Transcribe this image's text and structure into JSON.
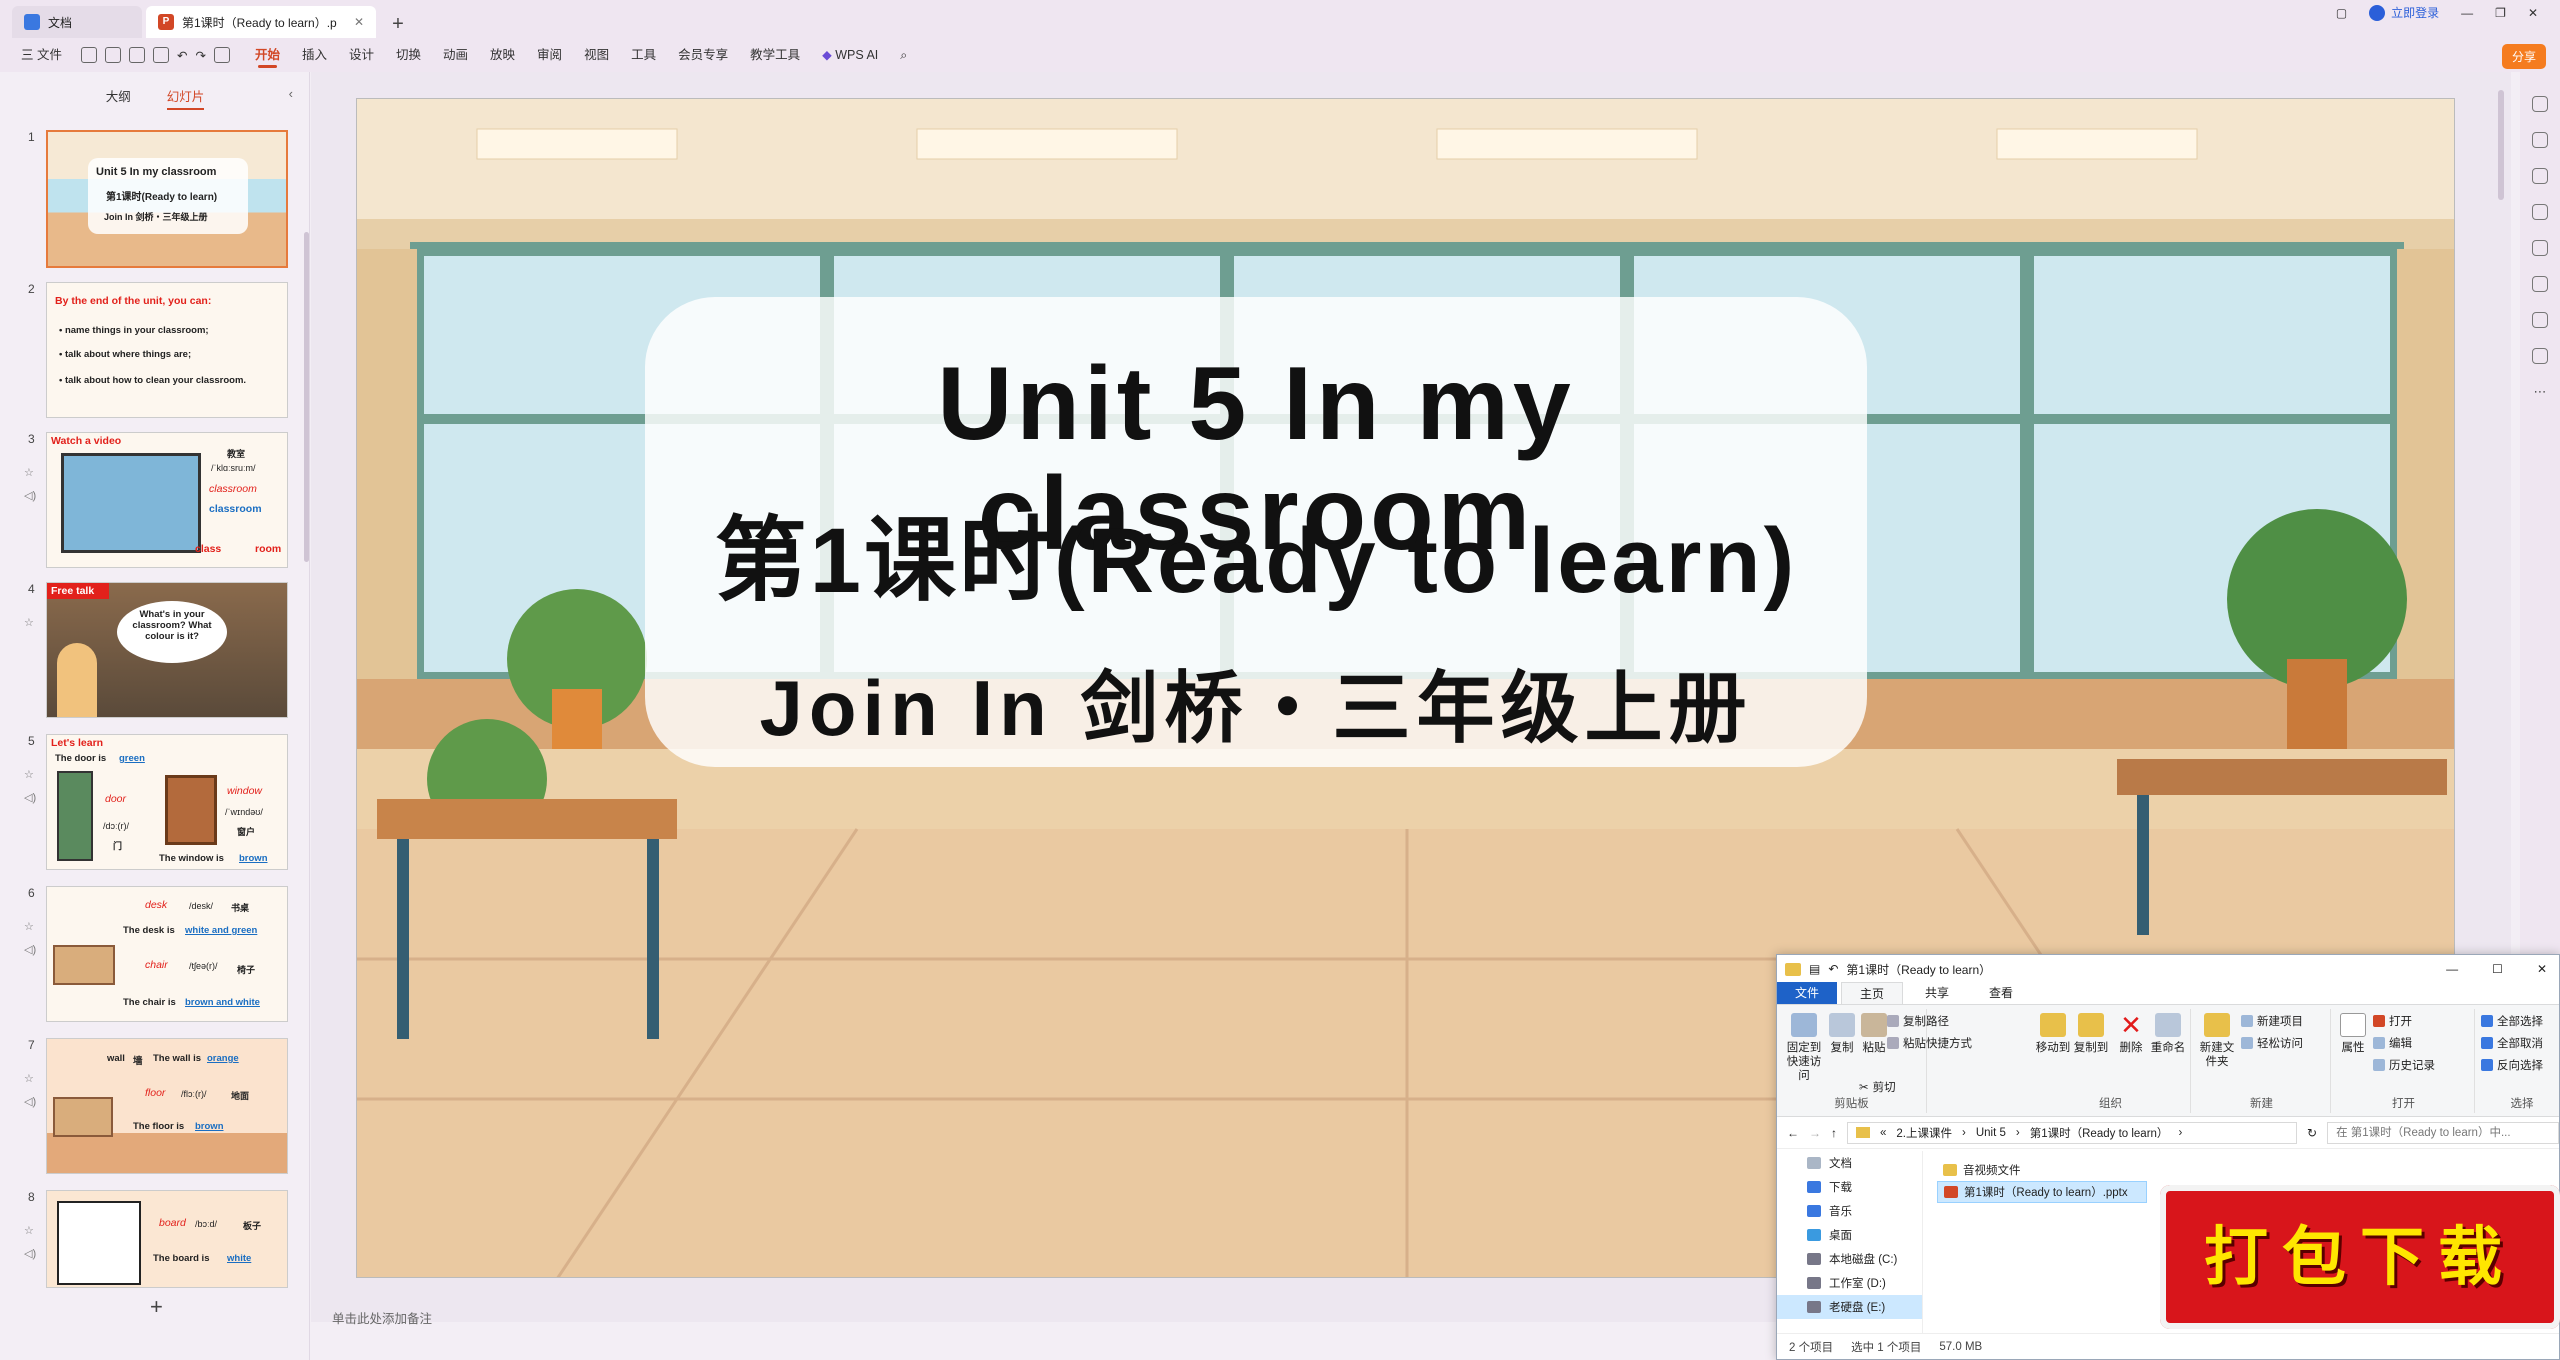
{
  "titlebar": {
    "tabs": [
      {
        "label": "文档"
      },
      {
        "label": "第1课时（Ready to learn）.p"
      }
    ],
    "login": "立即登录"
  },
  "menubar": {
    "file": "三 文件",
    "items": [
      "开始",
      "插入",
      "设计",
      "切换",
      "动画",
      "放映",
      "审阅",
      "视图",
      "工具",
      "会员专享",
      "教学工具"
    ],
    "active": "开始",
    "wps_ai": "WPS AI",
    "share": "分享"
  },
  "leftpanel": {
    "tabs": {
      "outline": "大纲",
      "slides": "幻灯片"
    },
    "thumbs": [
      {
        "num": "1",
        "lines": [
          "Unit 5 In my classroom",
          "第1课时(Ready to learn)",
          "Join In 剑桥・三年级上册"
        ]
      },
      {
        "num": "2",
        "title": "By the end of the unit, you can:",
        "bullets": [
          "name things in your classroom;",
          "talk about where things are;",
          "talk about how to clean your classroom."
        ]
      },
      {
        "num": "3",
        "title": "Watch a video",
        "words": [
          "教室",
          "/ˈklɑːsruːm/",
          "classroom",
          "classroom",
          "class",
          "room"
        ]
      },
      {
        "num": "4",
        "title": "Free talk",
        "bubble": "What's in your classroom? What colour is it?"
      },
      {
        "num": "5",
        "title": "Let's learn",
        "lines": [
          "The door is",
          "green",
          "door",
          "window",
          "/dɔː(r)/",
          "门",
          "/ˈwɪndəʊ/",
          "窗户",
          "The window is",
          "brown"
        ]
      },
      {
        "num": "6",
        "lines": [
          "desk",
          "/desk/",
          "书桌",
          "The desk is",
          "white and green",
          "chair",
          "/tʃeə(r)/",
          "椅子",
          "The chair is",
          "brown and white"
        ]
      },
      {
        "num": "7",
        "lines": [
          "wall",
          "墙",
          "The wall is",
          "orange",
          "floor",
          "/flɔː(r)/",
          "地面",
          "The floor is",
          "brown"
        ]
      },
      {
        "num": "8",
        "lines": [
          "board",
          "/bɔːd/",
          "板子",
          "The board is",
          "white"
        ]
      }
    ]
  },
  "slide": {
    "title": "Unit 5 In my classroom",
    "subtitle": "第1课时(Ready to learn)",
    "book": "Join In 剑桥・三年级上册"
  },
  "notes_placeholder": "单击此处添加备注",
  "explorer": {
    "title": "第1课时（Ready to learn）",
    "tabs": [
      "文件",
      "主页",
      "共享",
      "查看"
    ],
    "ribbon": {
      "clipboard": {
        "label": "剪贴板",
        "pin": "固定到快速访问",
        "copy": "复制",
        "paste": "粘贴",
        "copy_path": "复制路径",
        "paste_shortcut": "粘贴快捷方式",
        "cut": "剪切"
      },
      "organize": {
        "label": "组织",
        "move_to": "移动到",
        "copy_to": "复制到",
        "delete": "删除",
        "rename": "重命名"
      },
      "new": {
        "label": "新建",
        "new_folder": "新建文件夹",
        "new_item": "新建项目",
        "easy_access": "轻松访问"
      },
      "open": {
        "label": "打开",
        "properties": "属性",
        "open": "打开",
        "edit": "编辑",
        "history": "历史记录"
      },
      "select": {
        "label": "选择",
        "all": "全部选择",
        "none": "全部取消",
        "invert": "反向选择"
      }
    },
    "address": [
      "«",
      "2.上课课件",
      "Unit 5",
      "第1课时（Ready to learn）"
    ],
    "search_placeholder": "在 第1课时（Ready to learn）中...",
    "nav": [
      "文档",
      "下载",
      "音乐",
      "桌面",
      "本地磁盘 (C:)",
      "工作室 (D:)",
      "老硬盘 (E:)"
    ],
    "files": [
      "音视频文件",
      "第1课时（Ready to learn）.pptx"
    ],
    "status": {
      "count": "2 个项目",
      "selected": "选中 1 个项目",
      "size": "57.0 MB"
    }
  },
  "download_badge": "打包下载",
  "colors": {
    "accent": "#d24726",
    "badge_bg": "#d8151b",
    "badge_text": "#ffe600"
  }
}
